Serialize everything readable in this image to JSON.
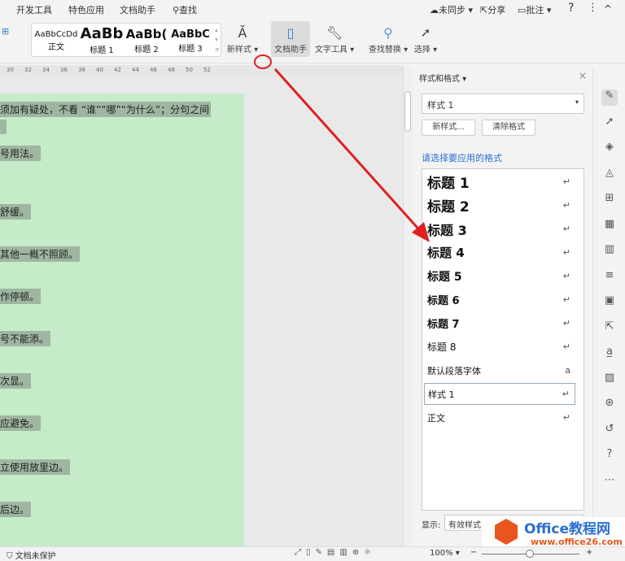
{
  "menubar": {
    "items": [
      "开发工具",
      "特色应用",
      "文档助手",
      "查找"
    ],
    "right": {
      "sync": "未同步",
      "share": "分享",
      "comment": "批注",
      "help": "?",
      "more": "⋮",
      "collapse": "^"
    }
  },
  "ribbon": {
    "gallery": [
      {
        "preview": "AaBbCcDd",
        "label": "正文"
      },
      {
        "preview": "AaBb",
        "label": "标题 1"
      },
      {
        "preview": "AaBb(",
        "label": "标题 2"
      },
      {
        "preview": "AaBbC",
        "label": "标题 3"
      }
    ],
    "buttons": {
      "new_style": "新样式",
      "doc_assistant": "文档助手",
      "text_tools": "文字工具",
      "find_replace": "查找替换",
      "select": "选择"
    }
  },
  "ruler": [
    "30",
    "32",
    "34",
    "36",
    "38",
    "40",
    "42",
    "44",
    "46",
    "48",
    "50",
    "52"
  ],
  "document": {
    "lines": [
      "须加有疑处，不看 “谁”“哪”“为什么”；分句之间",
      "",
      "号用法。",
      "舒缓。",
      "其他一概不照顾。",
      "作停顿。",
      "号不能添。",
      "次显。",
      "应避免。",
      "立使用放里边。",
      "后边。"
    ]
  },
  "panel": {
    "title": "样式和格式",
    "current_style": "样式 1",
    "new_style_button": "新样式...",
    "clear_format_button": "清除格式",
    "prompt": "请选择要应用的格式",
    "styles": [
      {
        "name": "标题 1",
        "mark": "↵"
      },
      {
        "name": "标题 2",
        "mark": "↵"
      },
      {
        "name": "标题 3",
        "mark": "↵"
      },
      {
        "name": "标题 4",
        "mark": "↵"
      },
      {
        "name": "标题 5",
        "mark": "↵"
      },
      {
        "name": "标题 6",
        "mark": "↵"
      },
      {
        "name": "标题 7",
        "mark": "↵"
      },
      {
        "name": "标题 8",
        "mark": "↵"
      },
      {
        "name": "默认段落字体",
        "mark": "a"
      },
      {
        "name": "样式 1",
        "mark": "↵"
      },
      {
        "name": "正文",
        "mark": "↵"
      }
    ],
    "show_label": "显示:",
    "show_value": "有效样式"
  },
  "status": {
    "protect": "文档未保护",
    "zoom": "100%"
  },
  "watermark": {
    "brand": "Office教程网",
    "url": "www.office26.com"
  },
  "colors": {
    "page": "#c6ebc9",
    "highlight": "#9fb6a0",
    "annotation": "#e02020",
    "link": "#2a6fd6"
  }
}
